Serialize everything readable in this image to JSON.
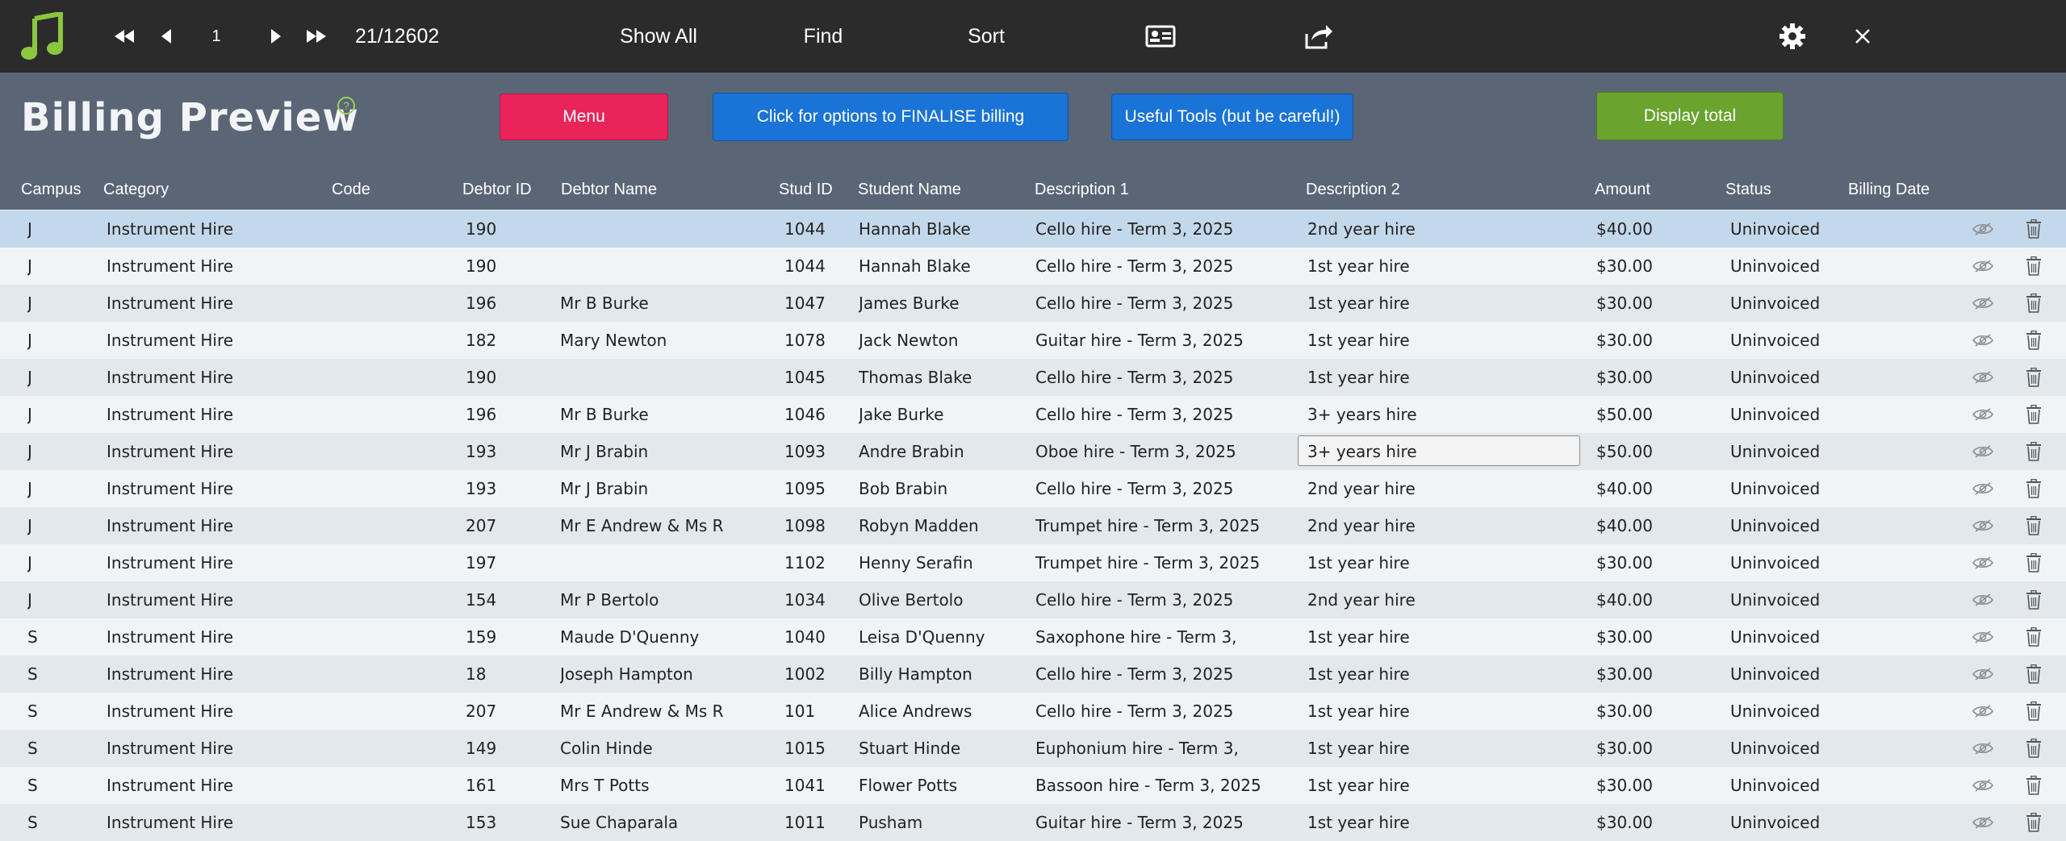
{
  "toolbar": {
    "record_number": "1",
    "record_count": "21/12602",
    "show_all": "Show All",
    "find": "Find",
    "sort": "Sort"
  },
  "header": {
    "title": "Billing Preview",
    "help": "?",
    "menu_button": "Menu",
    "finalise_button": "Click for options to FINALISE billing",
    "tools_button": "Useful Tools (but be careful!)",
    "total_button": "Display total"
  },
  "columns": {
    "campus": "Campus",
    "category": "Category",
    "code": "Code",
    "debtor_id": "Debtor ID",
    "debtor_name": "Debtor Name",
    "stud_id": "Stud ID",
    "student_name": "Student Name",
    "desc1": "Description 1",
    "desc2": "Description 2",
    "amount": "Amount",
    "status": "Status",
    "billing_date": "Billing Date"
  },
  "colors": {
    "menu": "#e8245a",
    "finalise": "#1a73d6",
    "tools": "#1a73d6",
    "total": "#6aa32e",
    "logo": "#8cc63f"
  },
  "rows": [
    {
      "campus": "J",
      "category": "Instrument Hire",
      "code": "",
      "debtor_id": "190",
      "debtor_name": "",
      "stud_id": "1044",
      "student_name": "Hannah Blake",
      "desc1": "Cello hire - Term 3, 2025",
      "desc2": "2nd year hire",
      "amount": "$40.00",
      "status": "Uninvoiced",
      "billing_date": ""
    },
    {
      "campus": "J",
      "category": "Instrument Hire",
      "code": "",
      "debtor_id": "190",
      "debtor_name": "",
      "stud_id": "1044",
      "student_name": "Hannah Blake",
      "desc1": "Cello hire - Term 3, 2025",
      "desc2": "1st year hire",
      "amount": "$30.00",
      "status": "Uninvoiced",
      "billing_date": ""
    },
    {
      "campus": "J",
      "category": "Instrument Hire",
      "code": "",
      "debtor_id": "196",
      "debtor_name": "Mr B Burke",
      "stud_id": "1047",
      "student_name": "James Burke",
      "desc1": "Cello hire - Term 3, 2025",
      "desc2": "1st year hire",
      "amount": "$30.00",
      "status": "Uninvoiced",
      "billing_date": ""
    },
    {
      "campus": "J",
      "category": "Instrument Hire",
      "code": "",
      "debtor_id": "182",
      "debtor_name": "Mary Newton",
      "stud_id": "1078",
      "student_name": "Jack Newton",
      "desc1": "Guitar hire - Term 3, 2025",
      "desc2": "1st year hire",
      "amount": "$30.00",
      "status": "Uninvoiced",
      "billing_date": ""
    },
    {
      "campus": "J",
      "category": "Instrument Hire",
      "code": "",
      "debtor_id": "190",
      "debtor_name": "",
      "stud_id": "1045",
      "student_name": "Thomas Blake",
      "desc1": "Cello hire - Term 3, 2025",
      "desc2": "1st year hire",
      "amount": "$30.00",
      "status": "Uninvoiced",
      "billing_date": ""
    },
    {
      "campus": "J",
      "category": "Instrument Hire",
      "code": "",
      "debtor_id": "196",
      "debtor_name": "Mr B Burke",
      "stud_id": "1046",
      "student_name": "Jake Burke",
      "desc1": "Cello hire - Term 3, 2025",
      "desc2": "3+ years hire",
      "amount": "$50.00",
      "status": "Uninvoiced",
      "billing_date": ""
    },
    {
      "campus": "J",
      "category": "Instrument Hire",
      "code": "",
      "debtor_id": "193",
      "debtor_name": "Mr J Brabin",
      "stud_id": "1093",
      "student_name": "Andre Brabin",
      "desc1": "Oboe hire - Term 3, 2025",
      "desc2": "3+ years hire",
      "amount": "$50.00",
      "status": "Uninvoiced",
      "billing_date": ""
    },
    {
      "campus": "J",
      "category": "Instrument Hire",
      "code": "",
      "debtor_id": "193",
      "debtor_name": "Mr J Brabin",
      "stud_id": "1095",
      "student_name": "Bob Brabin",
      "desc1": "Cello hire - Term 3, 2025",
      "desc2": "2nd year hire",
      "amount": "$40.00",
      "status": "Uninvoiced",
      "billing_date": ""
    },
    {
      "campus": "J",
      "category": "Instrument Hire",
      "code": "",
      "debtor_id": "207",
      "debtor_name": "Mr E Andrew & Ms R",
      "stud_id": "1098",
      "student_name": "Robyn Madden",
      "desc1": "Trumpet hire - Term 3, 2025",
      "desc2": "2nd year hire",
      "amount": "$40.00",
      "status": "Uninvoiced",
      "billing_date": ""
    },
    {
      "campus": "J",
      "category": "Instrument Hire",
      "code": "",
      "debtor_id": "197",
      "debtor_name": "",
      "stud_id": "1102",
      "student_name": "Henny Serafin",
      "desc1": "Trumpet hire - Term 3, 2025",
      "desc2": "1st year hire",
      "amount": "$30.00",
      "status": "Uninvoiced",
      "billing_date": ""
    },
    {
      "campus": "J",
      "category": "Instrument Hire",
      "code": "",
      "debtor_id": "154",
      "debtor_name": "Mr P Bertolo",
      "stud_id": "1034",
      "student_name": "Olive Bertolo",
      "desc1": "Cello hire - Term 3, 2025",
      "desc2": "2nd year hire",
      "amount": "$40.00",
      "status": "Uninvoiced",
      "billing_date": ""
    },
    {
      "campus": "S",
      "category": "Instrument Hire",
      "code": "",
      "debtor_id": "159",
      "debtor_name": "Maude D'Quenny",
      "stud_id": "1040",
      "student_name": "Leisa D'Quenny",
      "desc1": "Saxophone hire - Term 3,",
      "desc2": "1st year hire",
      "amount": "$30.00",
      "status": "Uninvoiced",
      "billing_date": ""
    },
    {
      "campus": "S",
      "category": "Instrument Hire",
      "code": "",
      "debtor_id": "18",
      "debtor_name": "Joseph Hampton",
      "stud_id": "1002",
      "student_name": "Billy Hampton",
      "desc1": "Cello hire - Term 3, 2025",
      "desc2": "1st year hire",
      "amount": "$30.00",
      "status": "Uninvoiced",
      "billing_date": ""
    },
    {
      "campus": "S",
      "category": "Instrument Hire",
      "code": "",
      "debtor_id": "207",
      "debtor_name": "Mr E Andrew & Ms R",
      "stud_id": "101",
      "student_name": "Alice Andrews",
      "desc1": "Cello hire - Term 3, 2025",
      "desc2": "1st year hire",
      "amount": "$30.00",
      "status": "Uninvoiced",
      "billing_date": ""
    },
    {
      "campus": "S",
      "category": "Instrument Hire",
      "code": "",
      "debtor_id": "149",
      "debtor_name": "Colin Hinde",
      "stud_id": "1015",
      "student_name": "Stuart Hinde",
      "desc1": "Euphonium hire - Term 3,",
      "desc2": "1st year hire",
      "amount": "$30.00",
      "status": "Uninvoiced",
      "billing_date": ""
    },
    {
      "campus": "S",
      "category": "Instrument Hire",
      "code": "",
      "debtor_id": "161",
      "debtor_name": "Mrs T Potts",
      "stud_id": "1041",
      "student_name": "Flower Potts",
      "desc1": "Bassoon hire - Term 3, 2025",
      "desc2": "1st year hire",
      "amount": "$30.00",
      "status": "Uninvoiced",
      "billing_date": ""
    },
    {
      "campus": "S",
      "category": "Instrument Hire",
      "code": "",
      "debtor_id": "153",
      "debtor_name": "Sue Chaparala",
      "stud_id": "1011",
      "student_name": "Pusham",
      "desc1": "Guitar hire - Term 3, 2025",
      "desc2": "1st year hire",
      "amount": "$30.00",
      "status": "Uninvoiced",
      "billing_date": ""
    }
  ]
}
